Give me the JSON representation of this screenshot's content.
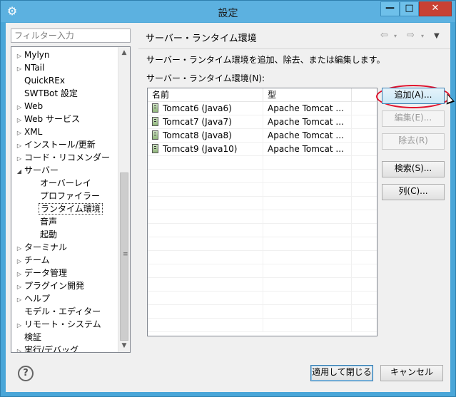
{
  "window": {
    "title": "設定"
  },
  "filter": {
    "placeholder": "フィルター入力"
  },
  "tree": {
    "items": [
      {
        "label": "Mylyn",
        "expander": "▷"
      },
      {
        "label": "NTail",
        "expander": "▷"
      },
      {
        "label": "QuickREx",
        "expander": ""
      },
      {
        "label": "SWTBot 設定",
        "expander": ""
      },
      {
        "label": "Web",
        "expander": "▷"
      },
      {
        "label": "Web サービス",
        "expander": "▷"
      },
      {
        "label": "XML",
        "expander": "▷"
      },
      {
        "label": "インストール/更新",
        "expander": "▷"
      },
      {
        "label": "コード・リコメンダー",
        "expander": "▷"
      },
      {
        "label": "サーバー",
        "expander": "◢"
      },
      {
        "label": "オーバーレイ",
        "expander": ""
      },
      {
        "label": "プロファイラー",
        "expander": ""
      },
      {
        "label": "ランタイム環境",
        "expander": ""
      },
      {
        "label": "音声",
        "expander": ""
      },
      {
        "label": "起動",
        "expander": ""
      },
      {
        "label": "ターミナル",
        "expander": "▷"
      },
      {
        "label": "チーム",
        "expander": "▷"
      },
      {
        "label": "データ管理",
        "expander": "▷"
      },
      {
        "label": "プラグイン開発",
        "expander": "▷"
      },
      {
        "label": "ヘルプ",
        "expander": "▷"
      },
      {
        "label": "モデル・エディター",
        "expander": ""
      },
      {
        "label": "リモート・システム",
        "expander": "▷"
      },
      {
        "label": "検証",
        "expander": ""
      },
      {
        "label": "実行/デバッグ",
        "expander": "▷"
      }
    ],
    "scroll_grip": "≡"
  },
  "page": {
    "title": "サーバー・ランタイム環境",
    "description": "サーバー・ランタイム環境を追加、除去、または編集します。",
    "list_label": "サーバー・ランタイム環境(N):"
  },
  "table": {
    "columns": [
      "名前",
      "型"
    ],
    "rows": [
      {
        "name": "Tomcat6 (Java6)",
        "type": "Apache Tomcat ..."
      },
      {
        "name": "Tomcat7 (Java7)",
        "type": "Apache Tomcat ..."
      },
      {
        "name": "Tomcat8 (Java8)",
        "type": "Apache Tomcat ..."
      },
      {
        "name": "Tomcat9 (Java10)",
        "type": "Apache Tomcat ..."
      }
    ]
  },
  "buttons": {
    "add": "追加(A)...",
    "edit": "編集(E)...",
    "remove": "除去(R)",
    "search": "検索(S)...",
    "columns": "列(C)...",
    "apply_close": "適用して閉じる",
    "cancel": "キャンセル"
  },
  "nav": {
    "back": "⇦",
    "forward": "⇨",
    "dropdown": "▾",
    "menu": "▼"
  },
  "help": {
    "glyph": "?"
  }
}
